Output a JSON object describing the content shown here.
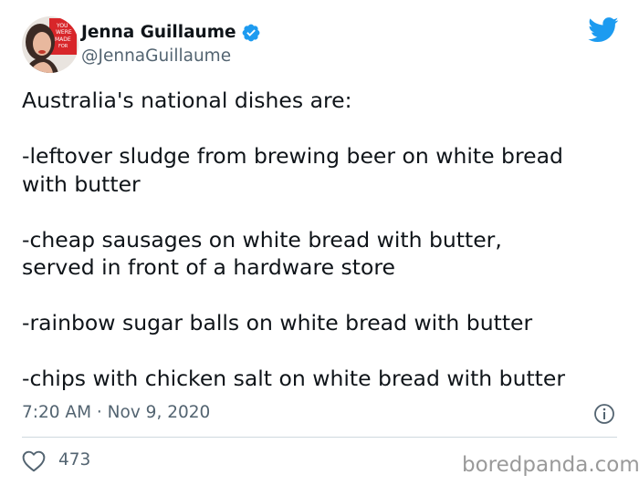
{
  "author": {
    "display_name": "Jenna Guillaume",
    "handle": "@JennaGuillaume",
    "verified": true
  },
  "tweet": {
    "lines": [
      "Australia's national dishes are:",
      "-leftover sludge from brewing beer on white bread",
      "with butter",
      "-cheap sausages on white bread with butter,",
      "served in front of a hardware store",
      "-rainbow sugar balls on white bread with butter",
      "-chips with chicken salt on white bread with butter"
    ],
    "timestamp": "7:20 AM · Nov 9, 2020"
  },
  "engagement": {
    "likes": "473"
  },
  "watermark": "boredpanda.com",
  "icons": {
    "verified": "verified-badge-icon",
    "brand": "twitter-bird-icon",
    "info": "info-icon",
    "like": "heart-icon"
  },
  "colors": {
    "twitter_blue": "#1d9bf0",
    "text_primary": "#0f1419",
    "text_secondary": "#536471",
    "divider": "#cfd9de",
    "watermark": "#9a9a9a"
  }
}
